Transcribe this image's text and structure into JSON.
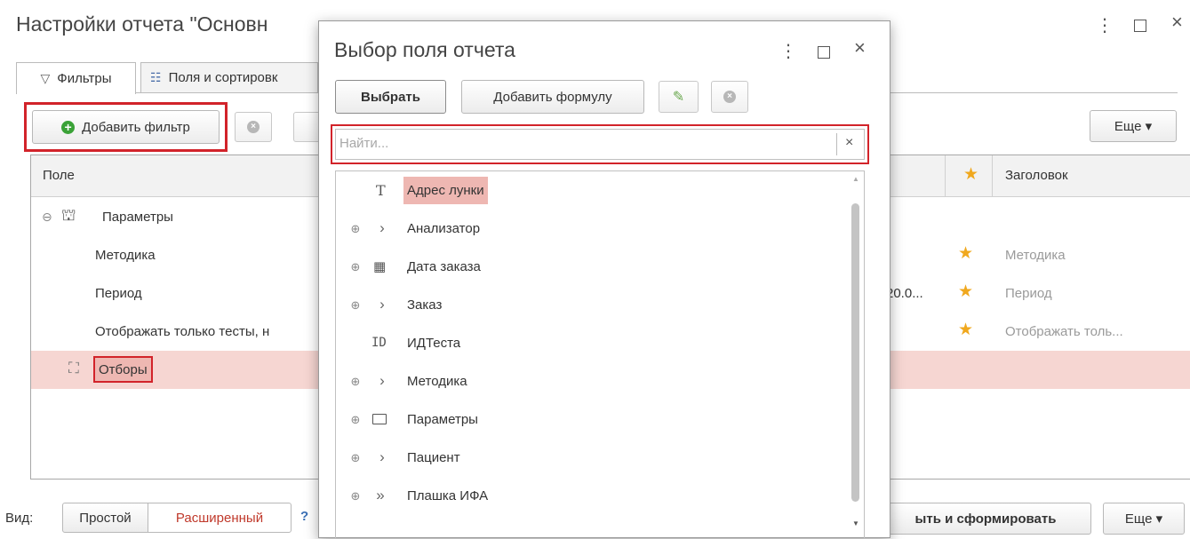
{
  "window": {
    "title": "Настройки отчета \"Основн",
    "menu_icon": "more-vert-icon",
    "maximize_icon": "maximize-icon",
    "close_icon": "close-icon"
  },
  "tabs": [
    {
      "label": "Фильтры",
      "icon": "filter-icon",
      "active": true
    },
    {
      "label": "Поля и сортировк",
      "icon": "fields-sort-icon",
      "active": false
    }
  ],
  "toolbar": {
    "add_filter_label": "Добавить фильтр",
    "more_label": "Еще ▾"
  },
  "table": {
    "col_field": "Поле",
    "col_title": "Заголовок",
    "rows": [
      {
        "label": "Параметры",
        "type": "group"
      },
      {
        "label": "Методика",
        "title": "Методика",
        "star": true
      },
      {
        "label": "Период",
        "value": "20.0...",
        "title": "Период",
        "star": true
      },
      {
        "label": "Отображать только тесты, н",
        "title": "Отображать толь...",
        "star": true
      },
      {
        "label": "Отборы",
        "type": "group",
        "selected": true
      }
    ]
  },
  "footer": {
    "view_label": "Вид:",
    "simple_label": "Простой",
    "advanced_label": "Расширенный",
    "help_label": "?",
    "run_label": "ыть и сформировать",
    "more_label": "Еще ▾"
  },
  "dialog": {
    "title": "Выбор поля отчета",
    "select_label": "Выбрать",
    "add_formula_label": "Добавить формулу",
    "search_placeholder": "Найти...",
    "search_clear": "×",
    "items": [
      {
        "label": "Адрес лунки",
        "icon": "T",
        "expandable": false,
        "highlight": true
      },
      {
        "label": "Анализатор",
        "icon": ">",
        "expandable": true
      },
      {
        "label": "Дата заказа",
        "icon": "calendar",
        "expandable": true
      },
      {
        "label": "Заказ",
        "icon": ">",
        "expandable": true
      },
      {
        "label": "ИДТеста",
        "icon": "ID",
        "expandable": false
      },
      {
        "label": "Методика",
        "icon": ">",
        "expandable": true
      },
      {
        "label": "Параметры",
        "icon": "folder",
        "expandable": true
      },
      {
        "label": "Пациент",
        "icon": ">",
        "expandable": true
      },
      {
        "label": "Плашка ИФА",
        "icon": ">>",
        "expandable": true
      }
    ]
  },
  "colors": {
    "highlight_border": "#d2232a",
    "selected_row": "#f6d6d2",
    "star": "#f0a81e",
    "advanced_text": "#c0392b"
  }
}
